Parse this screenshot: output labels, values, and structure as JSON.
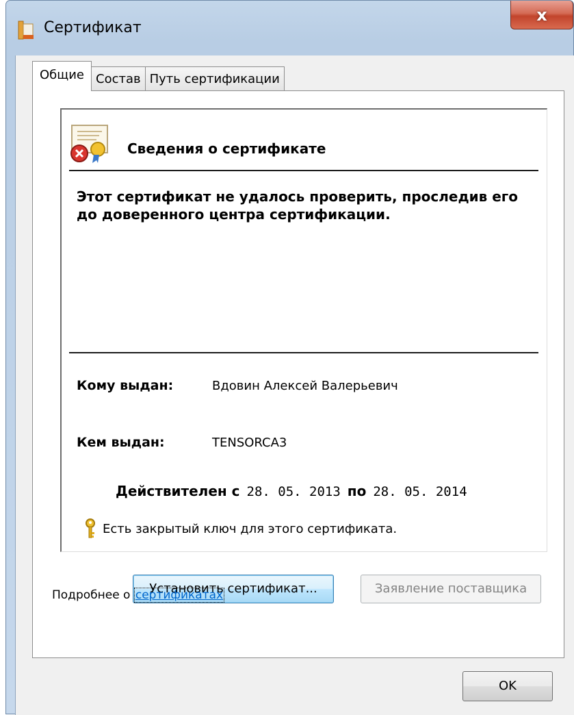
{
  "window": {
    "title": "Сертификат",
    "close_label": "x",
    "accent_color": "#c2442c"
  },
  "tabs": [
    {
      "label": "Общие",
      "active": true
    },
    {
      "label": "Состав",
      "active": false
    },
    {
      "label": "Путь сертификации",
      "active": false
    }
  ],
  "info": {
    "title": "Сведения о сертификате",
    "warning": "Этот сертификат не удалось проверить, проследив его до доверенного центра сертификации.",
    "issued_to_label": "Кому выдан:",
    "issued_to_value": "Вдовин Алексей Валерьевич",
    "issued_by_label": "Кем выдан:",
    "issued_by_value": "TENSORCA3",
    "valid_from_label": "Действителен с",
    "valid_from": "28. 05. 2013",
    "valid_to_label": "по",
    "valid_to": "28. 05. 2014",
    "private_key_text": "Есть закрытый ключ для этого сертификата."
  },
  "buttons": {
    "install": "Установить сертификат...",
    "issuer_statement": "Заявление поставщика",
    "ok": "OK"
  },
  "more_info": {
    "prefix": "Подробнее о ",
    "link": "сертификатах"
  },
  "icons": {
    "app": "certificate-app-icon",
    "cert": "certificate-error-icon",
    "key": "key-icon"
  }
}
